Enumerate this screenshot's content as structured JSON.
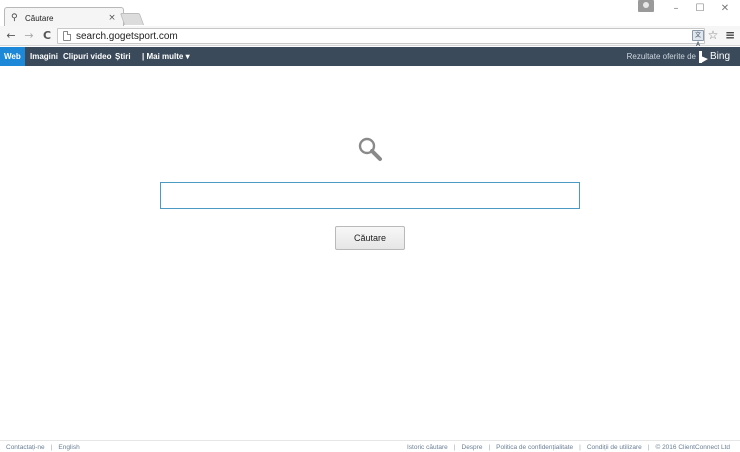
{
  "browser": {
    "tab_title": "Căutare",
    "tab_icon": "search-icon",
    "tab_close": "×",
    "url": "search.gogetsport.com",
    "translate_label": "文A"
  },
  "sitebar": {
    "items": [
      {
        "label": "Web",
        "active": true
      },
      {
        "label": "Imagini"
      },
      {
        "label": "Clipuri video"
      },
      {
        "label": "Știri"
      },
      {
        "label": "| Mai multe ▾"
      }
    ],
    "credit_text": "Rezultate oferite de",
    "credit_brand": "Bing",
    "bar_color": "#3a4a5a",
    "active_color": "#1e88d8"
  },
  "search": {
    "input_value": "",
    "button_label": "Căutare"
  },
  "footer": {
    "left": [
      "Contactați-ne",
      "English"
    ],
    "right": [
      "Istoric căutare",
      "Despre",
      "Politica de confidențialitate",
      "Condiții de utilizare",
      "© 2016 ClientConnect Ltd"
    ]
  }
}
